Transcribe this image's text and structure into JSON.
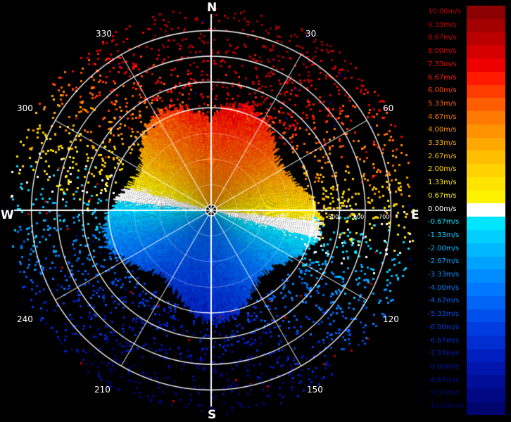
{
  "compass": {
    "north": "N",
    "south": "S",
    "east": "E",
    "west": "W"
  },
  "azimuth_labels": [
    "30",
    "60",
    "120",
    "150",
    "210",
    "240",
    "300",
    "330"
  ],
  "range_labels": [
    "100",
    "200",
    "300",
    "400",
    "500",
    "600",
    "700"
  ],
  "legend": {
    "entries": [
      {
        "label": "10.00m/s",
        "color": "#8b0000",
        "text_color": "#c00000"
      },
      {
        "label": "9.33m/s",
        "color": "#a30000",
        "text_color": "#c00000"
      },
      {
        "label": "8.67m/s",
        "color": "#bb0000",
        "text_color": "#d00000"
      },
      {
        "label": "8.00m/s",
        "color": "#d40000",
        "text_color": "#e00000"
      },
      {
        "label": "7.33m/s",
        "color": "#ee0000",
        "text_color": "#f00000"
      },
      {
        "label": "6.67m/s",
        "color": "#ff1a00",
        "text_color": "#ff2000"
      },
      {
        "label": "6.00m/s",
        "color": "#ff3c00",
        "text_color": "#ff4000"
      },
      {
        "label": "5.33m/s",
        "color": "#ff5e00",
        "text_color": "#ff6000"
      },
      {
        "label": "4.67m/s",
        "color": "#ff7a00",
        "text_color": "#ff7a00"
      },
      {
        "label": "4.00m/s",
        "color": "#ff9200",
        "text_color": "#ff9200"
      },
      {
        "label": "3.33m/s",
        "color": "#ffa800",
        "text_color": "#ffa800"
      },
      {
        "label": "2.67m/s",
        "color": "#ffbe00",
        "text_color": "#ffbe00"
      },
      {
        "label": "2.00m/s",
        "color": "#ffd200",
        "text_color": "#ffd200"
      },
      {
        "label": "1.33m/s",
        "color": "#ffe400",
        "text_color": "#ffe400"
      },
      {
        "label": "0.67m/s",
        "color": "#fff200",
        "text_color": "#fff200"
      },
      {
        "label": "0.00m/s",
        "color": "#ffffff",
        "text_color": "#ffffff"
      },
      {
        "label": "-0.67m/s",
        "color": "#00e5ff",
        "text_color": "#00e5ff"
      },
      {
        "label": "-1.33m/s",
        "color": "#00cfff",
        "text_color": "#00cfff"
      },
      {
        "label": "-2.00m/s",
        "color": "#00b8ff",
        "text_color": "#00b8ff"
      },
      {
        "label": "-2.67m/s",
        "color": "#00a2ff",
        "text_color": "#00a2ff"
      },
      {
        "label": "-3.33m/s",
        "color": "#008cff",
        "text_color": "#008cff"
      },
      {
        "label": "-4.00m/s",
        "color": "#0078ff",
        "text_color": "#0078ff"
      },
      {
        "label": "-4.67m/s",
        "color": "#0064f5",
        "text_color": "#0064f5"
      },
      {
        "label": "-5.33m/s",
        "color": "#0050eb",
        "text_color": "#0050eb"
      },
      {
        "label": "-6.00m/s",
        "color": "#003de0",
        "text_color": "#003de0"
      },
      {
        "label": "-6.67m/s",
        "color": "#002ed0",
        "text_color": "#002ed0"
      },
      {
        "label": "-7.33m/s",
        "color": "#0020bf",
        "text_color": "#0020bf"
      },
      {
        "label": "-8.00m/s",
        "color": "#0016ad",
        "text_color": "#0016ad"
      },
      {
        "label": "-8.67m/s",
        "color": "#000e98",
        "text_color": "#000e98"
      },
      {
        "label": "-9.33m/s",
        "color": "#000883",
        "text_color": "#000883"
      },
      {
        "label": "-10.00m/s",
        "color": "#00046e",
        "text_color": "#00046e"
      }
    ]
  }
}
